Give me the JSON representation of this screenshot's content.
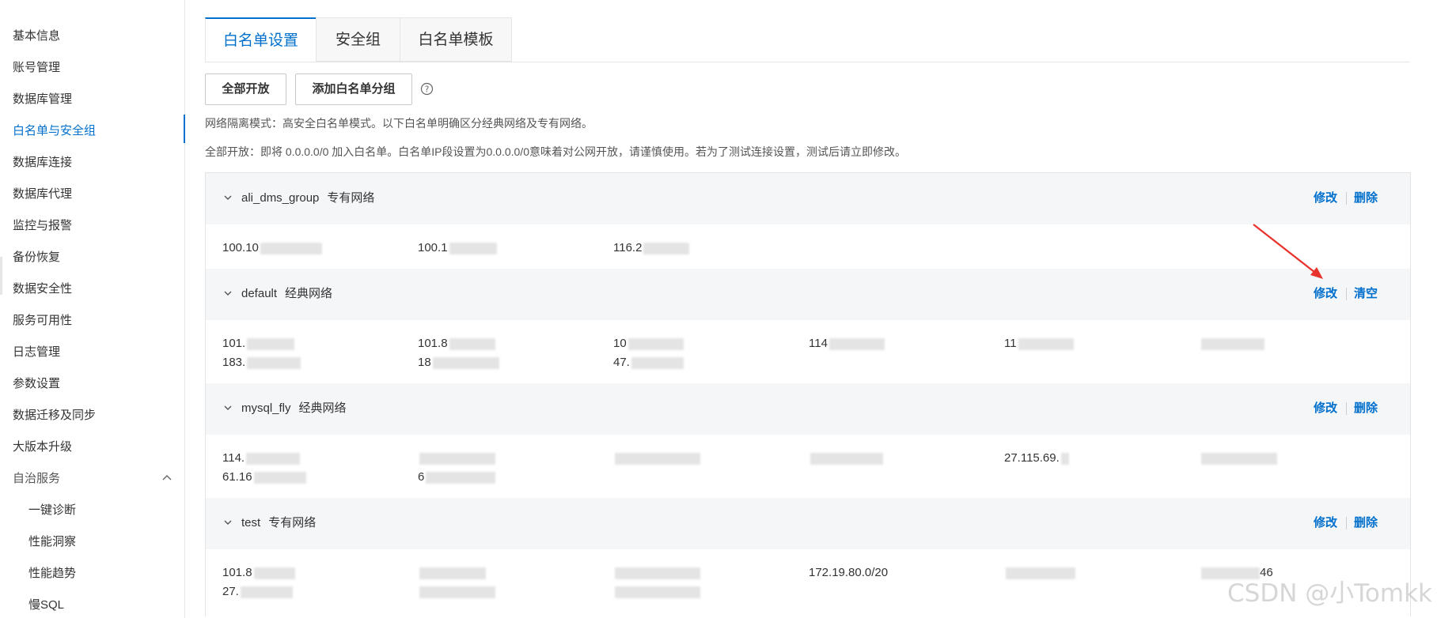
{
  "sidebar": {
    "items": [
      {
        "label": "基本信息"
      },
      {
        "label": "账号管理"
      },
      {
        "label": "数据库管理"
      },
      {
        "label": "白名单与安全组"
      },
      {
        "label": "数据库连接"
      },
      {
        "label": "数据库代理"
      },
      {
        "label": "监控与报警"
      },
      {
        "label": "备份恢复"
      },
      {
        "label": "数据安全性"
      },
      {
        "label": "服务可用性"
      },
      {
        "label": "日志管理"
      },
      {
        "label": "参数设置"
      },
      {
        "label": "数据迁移及同步"
      },
      {
        "label": "大版本升级"
      },
      {
        "label": "自治服务"
      }
    ],
    "sub_items": [
      {
        "label": "一键诊断"
      },
      {
        "label": "性能洞察"
      },
      {
        "label": "性能趋势"
      },
      {
        "label": "慢SQL"
      }
    ],
    "active_item": "白名单与安全组",
    "autonomy_expand_icon": "chevron-up-icon"
  },
  "tabs": [
    {
      "label": "白名单设置",
      "active": true
    },
    {
      "label": "安全组",
      "active": false
    },
    {
      "label": "白名单模板",
      "active": false
    }
  ],
  "toolbar": {
    "open_all_label": "全部开放",
    "add_group_label": "添加白名单分组",
    "help_icon": "question-circle-icon"
  },
  "notes": {
    "isolation_mode": "网络隔离模式：高安全白名单模式。以下白名单明确区分经典网络及专有网络。",
    "open_all_warning": "全部开放：即将 0.0.0.0/0 加入白名单。白名单IP段设置为0.0.0.0/0意味着对公网开放，请谨慎使用。若为了测试连接设置，测试后请立即修改。"
  },
  "groups": [
    {
      "name": "ali_dms_group",
      "network": "专有网络",
      "actions": [
        "修改",
        "删除"
      ],
      "rows": [
        [
          "100.10",
          "100.1",
          "116.2"
        ]
      ]
    },
    {
      "name": "default",
      "network": "经典网络",
      "actions": [
        "修改",
        "清空"
      ],
      "rows": [
        [
          "101.",
          "101.8",
          "10",
          "114",
          "11",
          ""
        ],
        [
          "183.",
          "18",
          "47."
        ]
      ]
    },
    {
      "name": "mysql_fly",
      "network": "经典网络",
      "actions": [
        "修改",
        "删除"
      ],
      "rows": [
        [
          "114.",
          "",
          "",
          "",
          "27.115.69.",
          ""
        ],
        [
          "61.16",
          "6"
        ]
      ]
    },
    {
      "name": "test",
      "network": "专有网络",
      "actions": [
        "修改",
        "删除"
      ],
      "rows": [
        [
          "101.8",
          "",
          "",
          "172.19.80.0/20",
          "",
          "46"
        ],
        [
          "27.",
          "",
          ""
        ]
      ]
    }
  ],
  "annotation": {
    "color": "#e8322c"
  },
  "colors": {
    "accent": "#0070cc",
    "group_header_bg": "#f5f6f8"
  },
  "watermark": "CSDN @小Tomkk"
}
